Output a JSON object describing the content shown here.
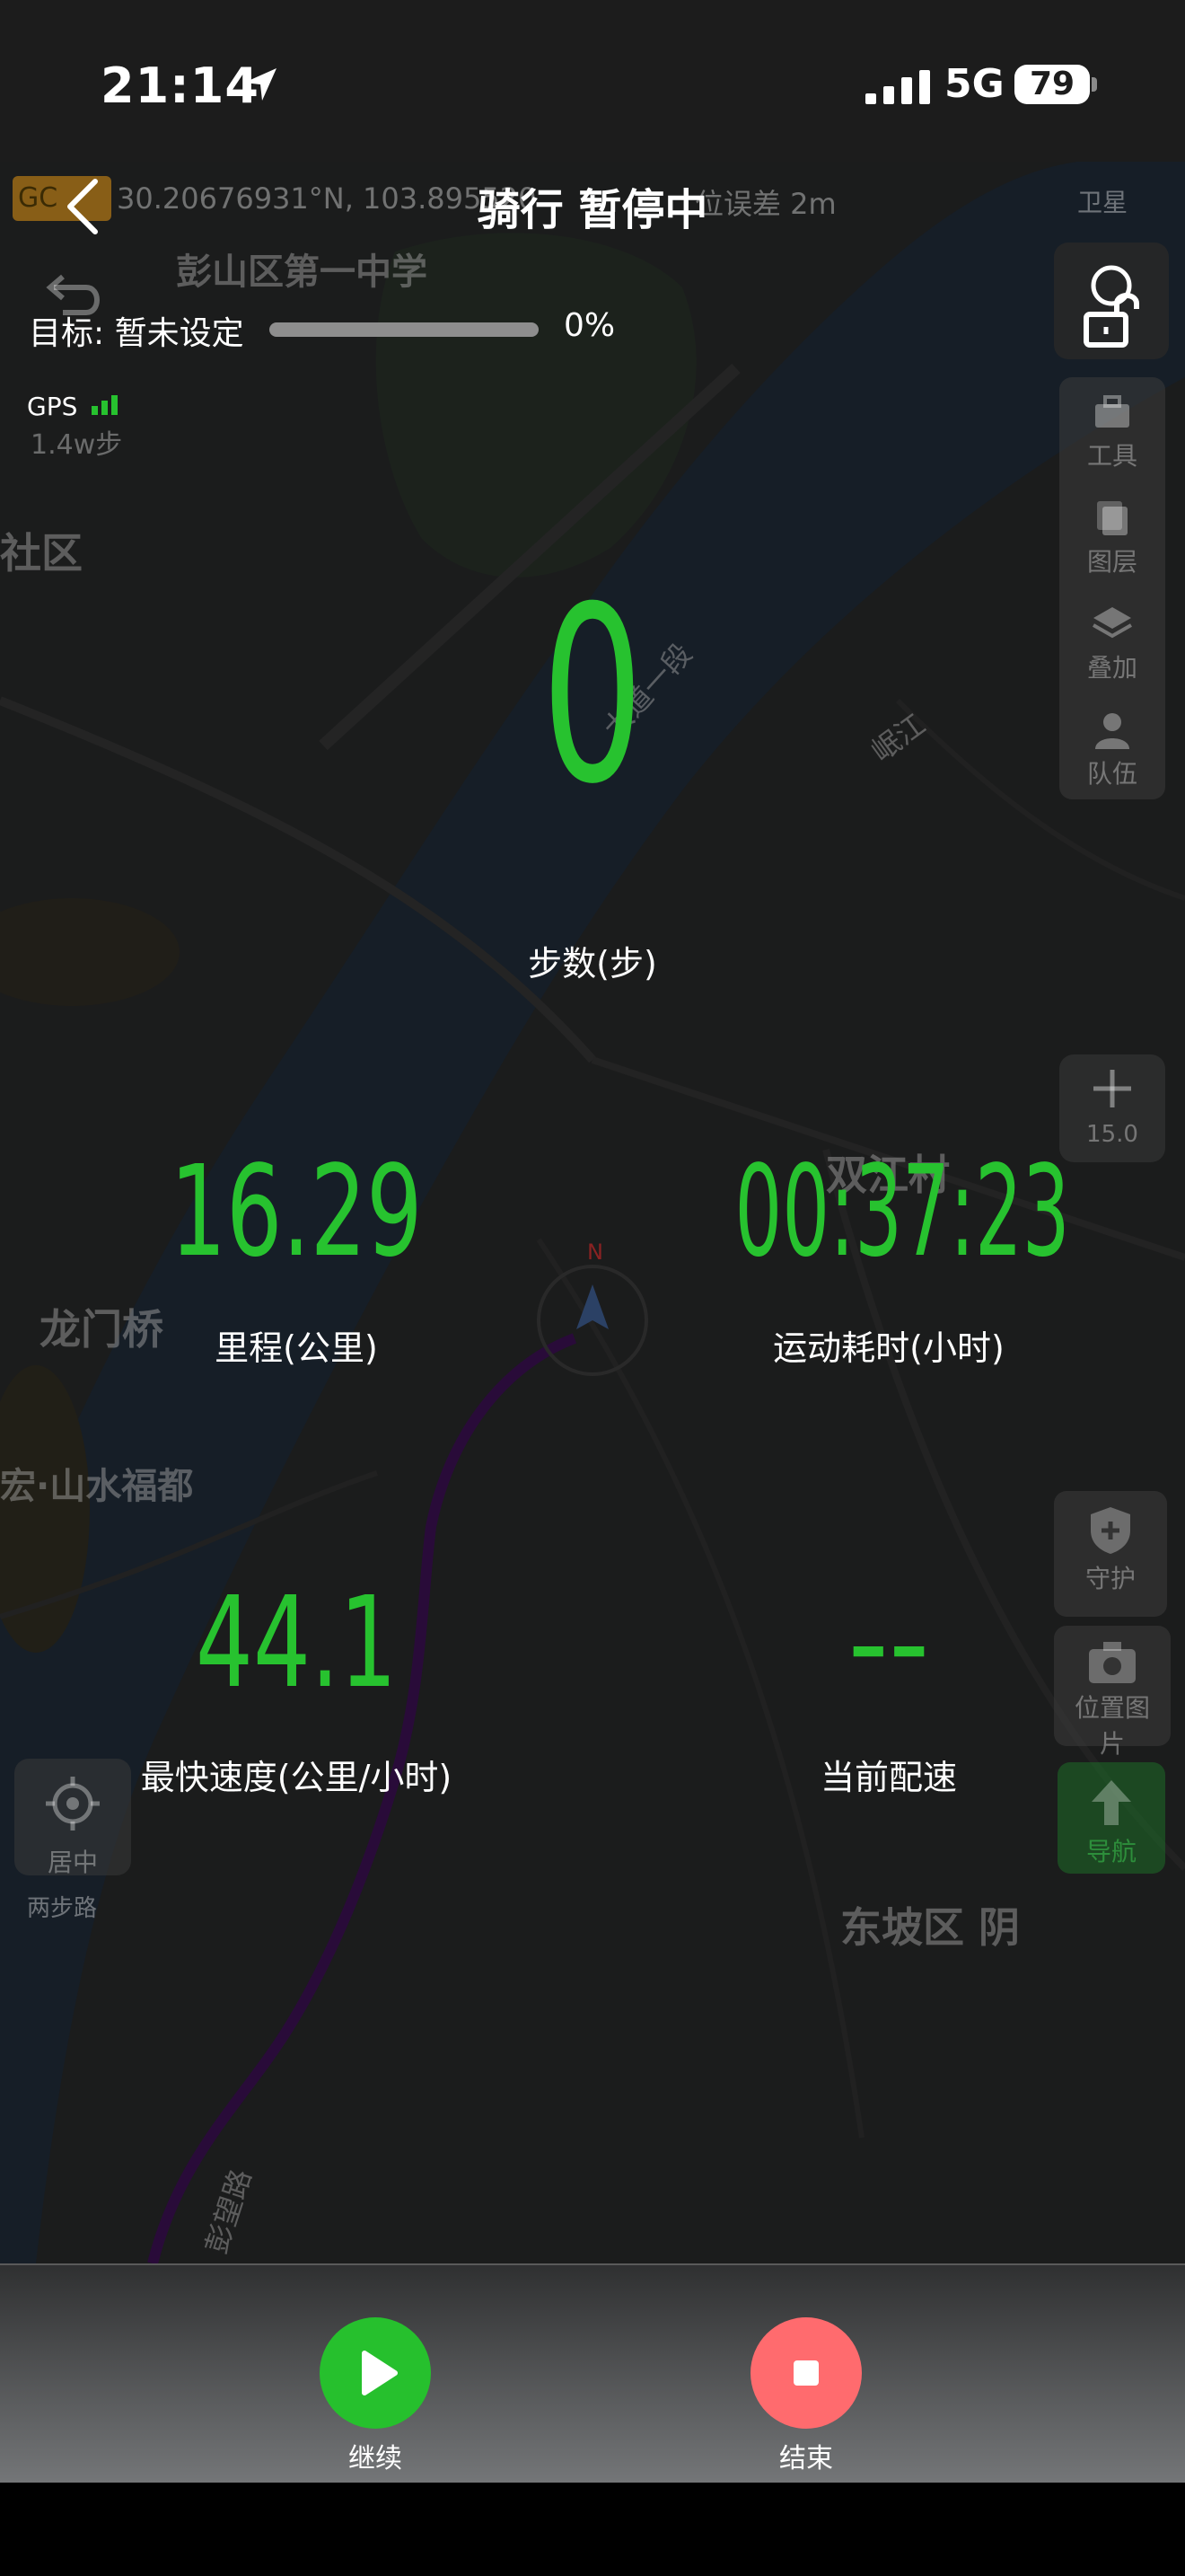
{
  "status_bar": {
    "time": "21:14",
    "network": "5G",
    "battery": "79"
  },
  "header": {
    "title": "骑行 暂停中",
    "gps_badge": "GC",
    "coordinates": "30.20676931°N, 103.895520",
    "accuracy": "位误差 2m",
    "satellite": "卫星"
  },
  "goal": {
    "label": "目标: 暂未设定",
    "percent_text": "0%",
    "progress": 0
  },
  "gps": {
    "label": "GPS",
    "faint_steps": "1.4w步"
  },
  "metrics": {
    "steps": {
      "value": "0",
      "label": "步数(步)"
    },
    "distance": {
      "value": "16.29",
      "label": "里程(公里)"
    },
    "duration": {
      "value": "00:37:23",
      "label": "运动耗时(小时)"
    },
    "top_speed": {
      "value": "44.1",
      "label": "最快速度(公里/小时)"
    },
    "pace": {
      "value": "--",
      "label": "当前配速"
    }
  },
  "map": {
    "labels": {
      "school": "彭山区第一中学",
      "community": "社区",
      "road": "大道一段",
      "river": "岷江",
      "village": "双江村",
      "bridge": "龙门桥",
      "estate": "宏·山水福都",
      "district": "东坡区 阴",
      "road2": "彭望路",
      "compass_n": "N"
    },
    "walk_badge": "两步路"
  },
  "tools": {
    "tool": "工具",
    "layers": "图层",
    "overlay": "叠加",
    "team": "队伍",
    "zoom_level": "15.0",
    "guard": "守护",
    "photo": "位置图片",
    "nav": "导航",
    "center": "居中"
  },
  "controls": {
    "resume": "继续",
    "end": "结束"
  },
  "colors": {
    "accent": "#27c22f",
    "end": "#ff6b6e",
    "track": "#3a1050"
  }
}
